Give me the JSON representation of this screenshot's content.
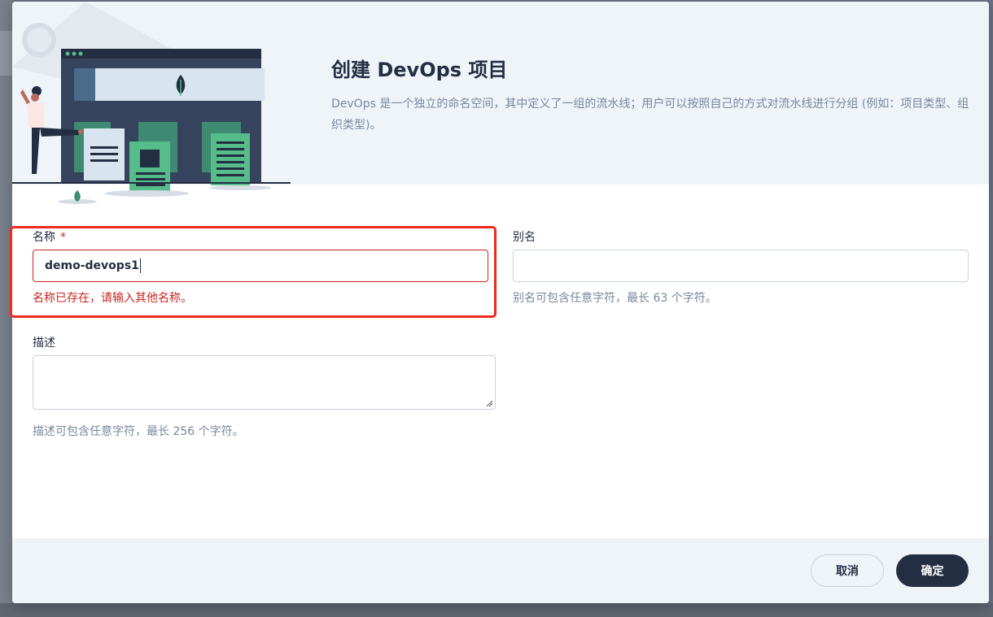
{
  "dialog": {
    "title": "创建 DevOps 项目",
    "description": "DevOps 是一个独立的命名空间，其中定义了一组的流水线；用户可以按照自己的方式对流水线进行分组 (例如：项目类型、组织类型)。"
  },
  "form": {
    "name": {
      "label": "名称",
      "required_mark": "*",
      "value": "demo-devops1",
      "error": "名称已存在，请输入其他名称。"
    },
    "alias": {
      "label": "别名",
      "value": "",
      "hint": "别名可包含任意字符，最长 63 个字符。"
    },
    "description": {
      "label": "描述",
      "value": "",
      "hint": "描述可包含任意字符，最长 256 个字符。"
    }
  },
  "footer": {
    "cancel_label": "取消",
    "ok_label": "确定"
  },
  "colors": {
    "primary_dark": "#242e42",
    "error": "#ca2621",
    "highlight_border": "#ef2a1e",
    "header_bg": "#eff4f9",
    "accent_green": "#55bc8a"
  },
  "icons": {
    "illustration": "devops-building-illustration",
    "resize": "textarea-resize-icon"
  }
}
